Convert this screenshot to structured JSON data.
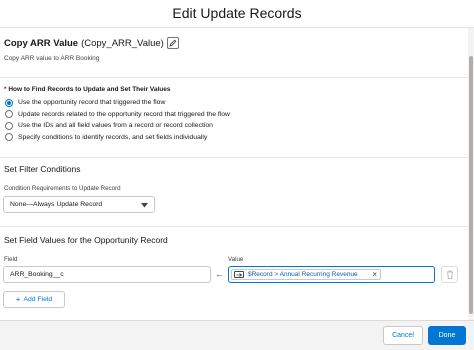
{
  "modal": {
    "title": "Edit Update Records"
  },
  "element": {
    "label": "Copy ARR Value",
    "api_name": "(Copy_ARR_Value)",
    "description": "Copy ARR value to ARR Booking"
  },
  "find_records": {
    "required_marker": "*",
    "heading": "How to Find Records to Update and Set Their Values",
    "selected_index": 0,
    "options": [
      "Use the opportunity record that triggered the flow",
      "Update records related to the opportunity record that triggered the flow",
      "Use the IDs and all field values from a record or record collection",
      "Specify conditions to identify records, and set fields individually"
    ]
  },
  "filter": {
    "title": "Set Filter Conditions",
    "requirement_label": "Condition Requirements to Update Record",
    "requirement_value": "None—Always Update Record"
  },
  "field_values": {
    "title": "Set Field Values for the Opportunity Record",
    "field_label": "Field",
    "value_label": "Value",
    "field_value": "ARR_Booking__c",
    "value_pill": "$Record > Annual Recurring Revenue",
    "add_label": "Add Field"
  },
  "footer": {
    "cancel_label": "Cancel",
    "done_label": "Done"
  },
  "colors": {
    "brand": "#0176d3",
    "required": "#ba0517"
  },
  "icons": [
    "pencil-icon",
    "chevron-down-icon",
    "left-arrow-icon",
    "resource-icon",
    "close-icon",
    "trash-icon",
    "plus-icon"
  ]
}
